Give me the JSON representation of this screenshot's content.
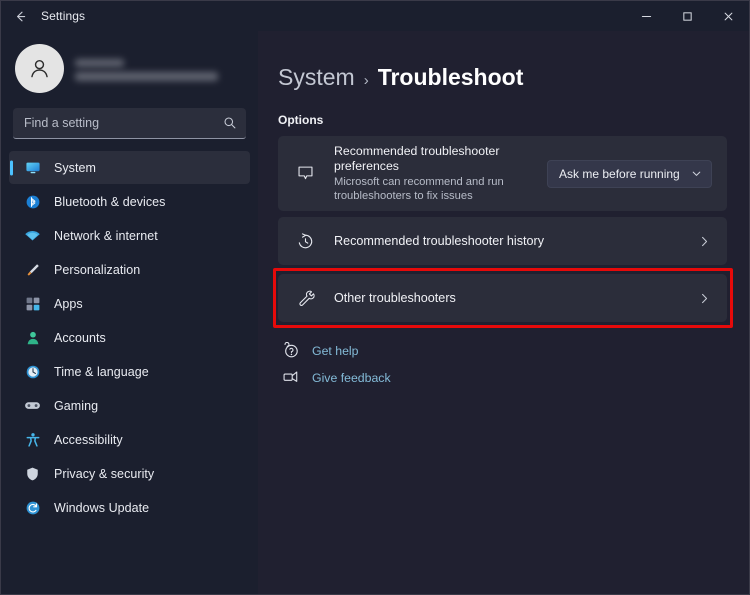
{
  "window": {
    "titlebar_title": "Settings",
    "back_icon": "arrow-left-icon",
    "minimize_label": "—",
    "maximize_label": "□",
    "close_label": "✕"
  },
  "theme": {
    "app_background": "#202030",
    "sidebar_background": "#1b1f2e",
    "card_background": "#2b2d3a",
    "accent_selected": "#4cc2ff",
    "link_color": "#84bbd8",
    "highlight_border": "#e60a0a",
    "text_primary": "#f1f2f6",
    "text_secondary": "#b7bcc8"
  },
  "account": {
    "name": "",
    "email": "",
    "name_redacted": true,
    "email_redacted": true,
    "avatar_icon": "person-icon"
  },
  "search": {
    "placeholder": "Find a setting",
    "value": "",
    "icon": "search-icon"
  },
  "sidebar": {
    "items": [
      {
        "label": "System",
        "icon": "monitor-icon",
        "selected": true
      },
      {
        "label": "Bluetooth & devices",
        "icon": "bluetooth-icon",
        "selected": false
      },
      {
        "label": "Network & internet",
        "icon": "wifi-icon",
        "selected": false
      },
      {
        "label": "Personalization",
        "icon": "paintbrush-icon",
        "selected": false
      },
      {
        "label": "Apps",
        "icon": "apps-grid-icon",
        "selected": false
      },
      {
        "label": "Accounts",
        "icon": "account-icon",
        "selected": false
      },
      {
        "label": "Time & language",
        "icon": "clock-icon",
        "selected": false
      },
      {
        "label": "Gaming",
        "icon": "gamepad-icon",
        "selected": false
      },
      {
        "label": "Accessibility",
        "icon": "accessibility-icon",
        "selected": false
      },
      {
        "label": "Privacy & security",
        "icon": "shield-icon",
        "selected": false
      },
      {
        "label": "Windows Update",
        "icon": "update-icon",
        "selected": false
      }
    ]
  },
  "main": {
    "breadcrumb": {
      "parent": "System",
      "separator": "›",
      "current": "Troubleshoot"
    },
    "section_label": "Options",
    "cards": [
      {
        "icon": "speech-bubble-icon",
        "title": "Recommended troubleshooter preferences",
        "subtitle": "Microsoft can recommend and run troubleshooters to fix issues",
        "control": "dropdown",
        "dropdown_value": "Ask me before running",
        "dropdown_icon": "chevron-down-icon"
      },
      {
        "icon": "history-icon",
        "title": "Recommended troubleshooter history",
        "subtitle": "",
        "control": "chevron",
        "chevron_icon": "chevron-right-icon"
      },
      {
        "icon": "wrench-icon",
        "title": "Other troubleshooters",
        "subtitle": "",
        "control": "chevron",
        "chevron_icon": "chevron-right-icon",
        "highlighted": true
      }
    ],
    "links": [
      {
        "label": "Get help",
        "icon": "help-icon"
      },
      {
        "label": "Give feedback",
        "icon": "feedback-icon"
      }
    ]
  }
}
